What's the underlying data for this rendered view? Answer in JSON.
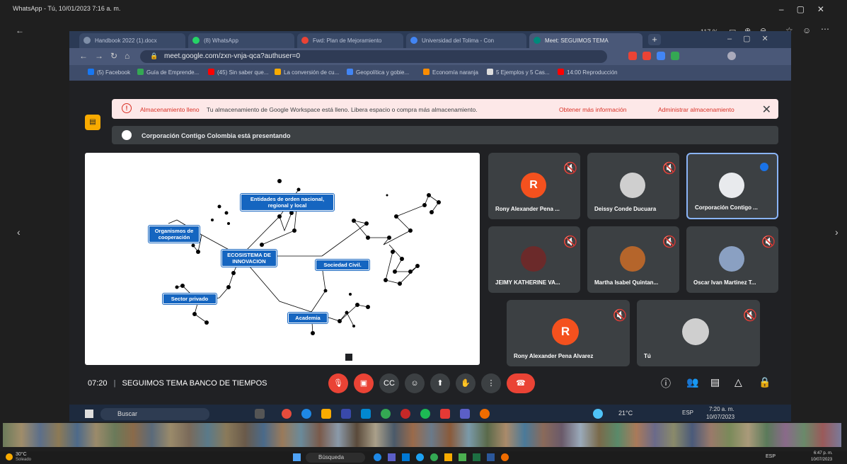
{
  "viewer": {
    "title": "WhatsApp - Tú, 10/01/2023 7:16 a. m.",
    "zoom": "117 %",
    "back_label": "←"
  },
  "browser": {
    "tabs": [
      {
        "label": "Handbook 2022 (1).docx",
        "color": "#7f8fa8"
      },
      {
        "label": "(8) WhatsApp",
        "color": "#25d366"
      },
      {
        "label": "Fwd: Plan de Mejoramiento",
        "color": "#ea4335"
      },
      {
        "label": "Universidad del Tolima - Con",
        "color": "#4285f4"
      },
      {
        "label": "Meet: SEGUIMOS TEMA",
        "color": "#00897b"
      }
    ],
    "url": "meet.google.com/zxn-vnja-qca?authuser=0",
    "bookmarks": [
      "(5) Facebook",
      "Guía de Emprende...",
      "(45) Sin saber que...",
      "La conversión de cu...",
      "Geopolítica y gobie...",
      "Economía naranja",
      "5 Ejemplos y 5 Cas...",
      "14:00 Reproducción"
    ]
  },
  "meet": {
    "banner": {
      "title": "Almacenamiento lleno",
      "message": "Tu almacenamiento de Google Workspace está lleno. Libera espacio o compra más almacenamiento.",
      "link_more": "Obtener más información",
      "link_manage": "Administrar almacenamiento",
      "close": "✕"
    },
    "presenting": "Corporación Contigo Colombia está presentando",
    "slide": {
      "nodes": {
        "entidades": "Entidades de orden nacional, regional y local",
        "organismos": "Organismos de cooperación",
        "ecosistema": "ECOSISTEMA DE INNOVACION",
        "sociedad": "Sociedad Civil.",
        "sector": "Sector privado",
        "academia": "Academia"
      }
    },
    "participants": [
      {
        "name": "Rony Alexander Pena ...",
        "avatar": "R",
        "avatar_color": "#f4511e"
      },
      {
        "name": "Deissy Conde Ducuara",
        "avatar": "",
        "avatar_color": "#cfcfcf"
      },
      {
        "name": "Corporación Contigo ...",
        "avatar": "",
        "avatar_color": "#e8eaed"
      },
      {
        "name": "JEIMY KATHERINE VA...",
        "avatar": "",
        "avatar_color": "#6b2a2a"
      },
      {
        "name": "Martha Isabel Quintan...",
        "avatar": "",
        "avatar_color": "#b5652b"
      },
      {
        "name": "Oscar Ivan Martinez T...",
        "avatar": "",
        "avatar_color": "#8aa0c2"
      },
      {
        "name": "Rony Alexander Pena Alvarez",
        "avatar": "R",
        "avatar_color": "#f4511e"
      },
      {
        "name": "Tú",
        "avatar": "",
        "avatar_color": "#cfcfcf"
      }
    ],
    "time": "07:20",
    "meeting_title": "SEGUIMOS TEMA BANCO DE TIEMPOS"
  },
  "photo_taskbar": {
    "search": "Buscar",
    "weather": "21°C",
    "lang": "ESP",
    "time": "7:20 a. m.",
    "date": "10/07/2023"
  },
  "taskbar": {
    "weather_temp": "30°C",
    "weather_desc": "Soleado",
    "search": "Búsqueda",
    "lang": "ESP",
    "time": "6:47 p. m.",
    "date": "10/07/2023"
  }
}
